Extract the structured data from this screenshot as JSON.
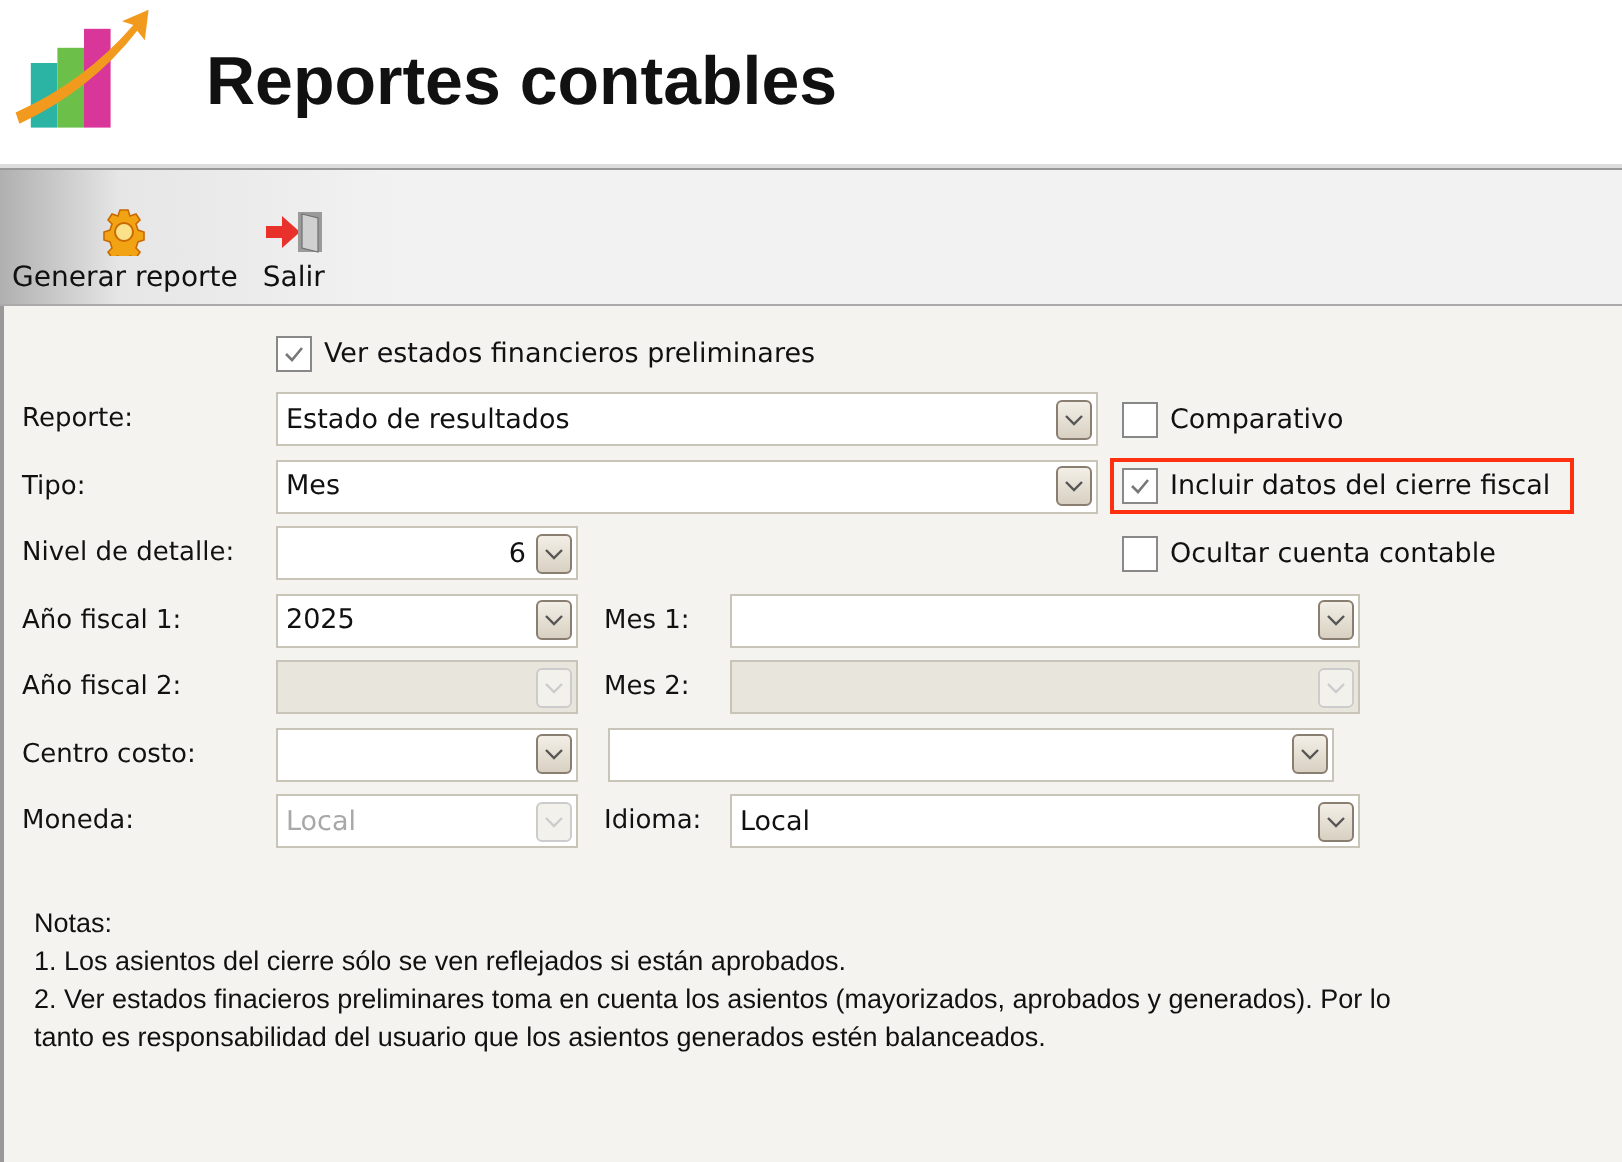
{
  "header": {
    "title": "Reportes contables"
  },
  "toolbar": [
    {
      "label": "Generar reporte",
      "kind": "gear"
    },
    {
      "label": "Salir",
      "kind": "exit"
    }
  ],
  "preliminary": {
    "label": "Ver estados financieros preliminares",
    "checked": true
  },
  "options": [
    {
      "label": "Comparativo",
      "checked": false,
      "highlighted": false
    },
    {
      "label": "Incluir datos del cierre fiscal",
      "checked": true,
      "highlighted": true
    },
    {
      "label": "Ocultar cuenta contable",
      "checked": false,
      "highlighted": false
    }
  ],
  "rows": [
    {
      "kind": "wide",
      "label": "Reporte:",
      "field": {
        "value": "Estado de resultados",
        "disabled": false,
        "shaded": false
      }
    },
    {
      "kind": "wide",
      "label": "Tipo:",
      "field": {
        "value": "Mes",
        "disabled": false,
        "shaded": false
      }
    },
    {
      "kind": "number",
      "label": "Nivel de detalle:",
      "field": {
        "value": "6",
        "disabled": false,
        "shaded": false
      }
    },
    {
      "kind": "pair",
      "label": "Año fiscal 1:",
      "field": {
        "value": "2025",
        "disabled": false,
        "shaded": false
      },
      "second": {
        "label": "Mes 1:",
        "disabled": false,
        "shaded": false
      }
    },
    {
      "kind": "pair",
      "label": "Año fiscal 2:",
      "field": {
        "disabled": true,
        "shaded": true
      },
      "second": {
        "label": "Mes 2:",
        "disabled": true,
        "shaded": true
      }
    },
    {
      "kind": "pair",
      "label": "Centro costo:",
      "field": {
        "disabled": false,
        "shaded": false
      },
      "second": {
        "disabled": false,
        "shaded": false
      }
    },
    {
      "kind": "pair",
      "label": "Moneda:",
      "field": {
        "value": "Local",
        "disabled": true,
        "shaded": false
      },
      "second": {
        "label": "Idioma:",
        "value": "Local",
        "disabled": false,
        "shaded": false
      }
    }
  ],
  "notes": [
    "Notas:",
    "1. Los asientos del cierre sólo se ven reflejados si están aprobados.",
    "2. Ver estados finacieros preliminares toma en cuenta los asientos (mayorizados, aprobados y generados). Por lo tanto es responsabilidad del usuario que los asientos generados estén balanceados."
  ]
}
